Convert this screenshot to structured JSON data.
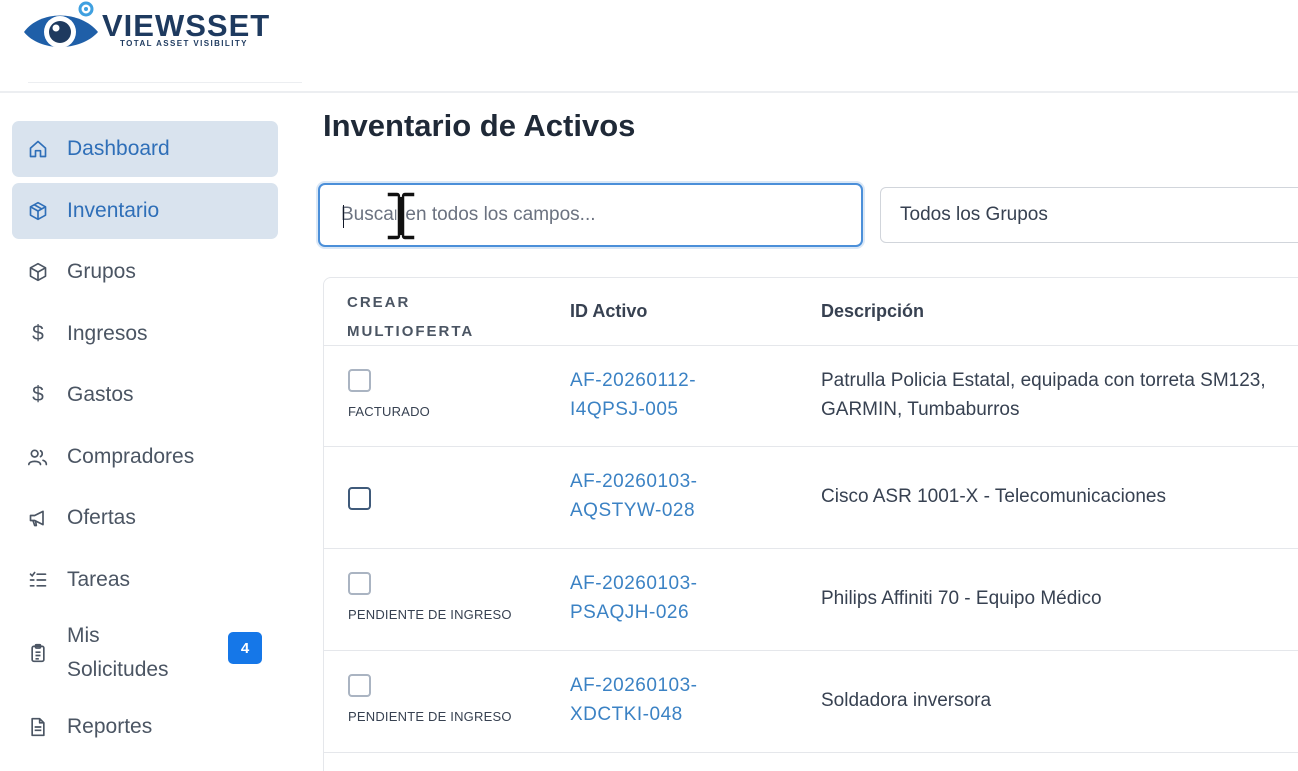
{
  "brand": {
    "name": "VIEWSSET",
    "tagline": "TOTAL ASSET VISIBILITY"
  },
  "sidebar": {
    "items": [
      {
        "label": "Dashboard",
        "icon": "home-icon",
        "active": true
      },
      {
        "label": "Inventario",
        "icon": "box-icon",
        "active": true
      },
      {
        "label": "Grupos",
        "icon": "cube-icon",
        "active": false
      },
      {
        "label": "Ingresos",
        "icon": "dollar-icon",
        "active": false
      },
      {
        "label": "Gastos",
        "icon": "dollar-icon",
        "active": false
      },
      {
        "label": "Compradores",
        "icon": "users-icon",
        "active": false
      },
      {
        "label": "Ofertas",
        "icon": "megaphone-icon",
        "active": false
      },
      {
        "label": "Tareas",
        "icon": "checklist-icon",
        "active": false
      },
      {
        "label": "Mis Solicitudes",
        "label_line1": "Mis",
        "label_line2": "Solicitudes",
        "icon": "clipboard-icon",
        "active": false,
        "badge": "4"
      },
      {
        "label": "Reportes",
        "icon": "document-icon",
        "active": false
      }
    ]
  },
  "main": {
    "title": "Inventario de Activos",
    "search": {
      "placeholder": "Buscar en todos los campos...",
      "value": ""
    },
    "group_filter": {
      "selected": "Todos los Grupos"
    },
    "table": {
      "headers": {
        "crear_line1": "CREAR",
        "crear_line2": "MULTIOFERTA",
        "id": "ID Activo",
        "description": "Descripción"
      },
      "rows": [
        {
          "status": "FACTURADO",
          "id_line1": "AF-20260112-",
          "id_line2": "I4QPSJ-005",
          "desc_line1": "Patrulla Policia Estatal, equipada con torreta SM123,",
          "desc_line2": "GARMIN, Tumbaburros"
        },
        {
          "status": "",
          "id_line1": "AF-20260103-",
          "id_line2": "AQSTYW-028",
          "desc_line1": "Cisco ASR 1001-X - Telecomunicaciones",
          "desc_line2": ""
        },
        {
          "status": "PENDIENTE DE INGRESO",
          "id_line1": "AF-20260103-",
          "id_line2": "PSAQJH-026",
          "desc_line1": "Philips Affiniti 70 - Equipo Médico",
          "desc_line2": ""
        },
        {
          "status": "PENDIENTE DE INGRESO",
          "id_line1": "AF-20260103-",
          "id_line2": "XDCTKI-048",
          "desc_line1": "Soldadora inversora",
          "desc_line2": ""
        }
      ]
    }
  },
  "colors": {
    "accent": "#2f6fb8",
    "active_bg": "#d9e3ee",
    "link": "#3b82c4",
    "badge": "#1577e8",
    "brand": "#1e3a5f"
  }
}
